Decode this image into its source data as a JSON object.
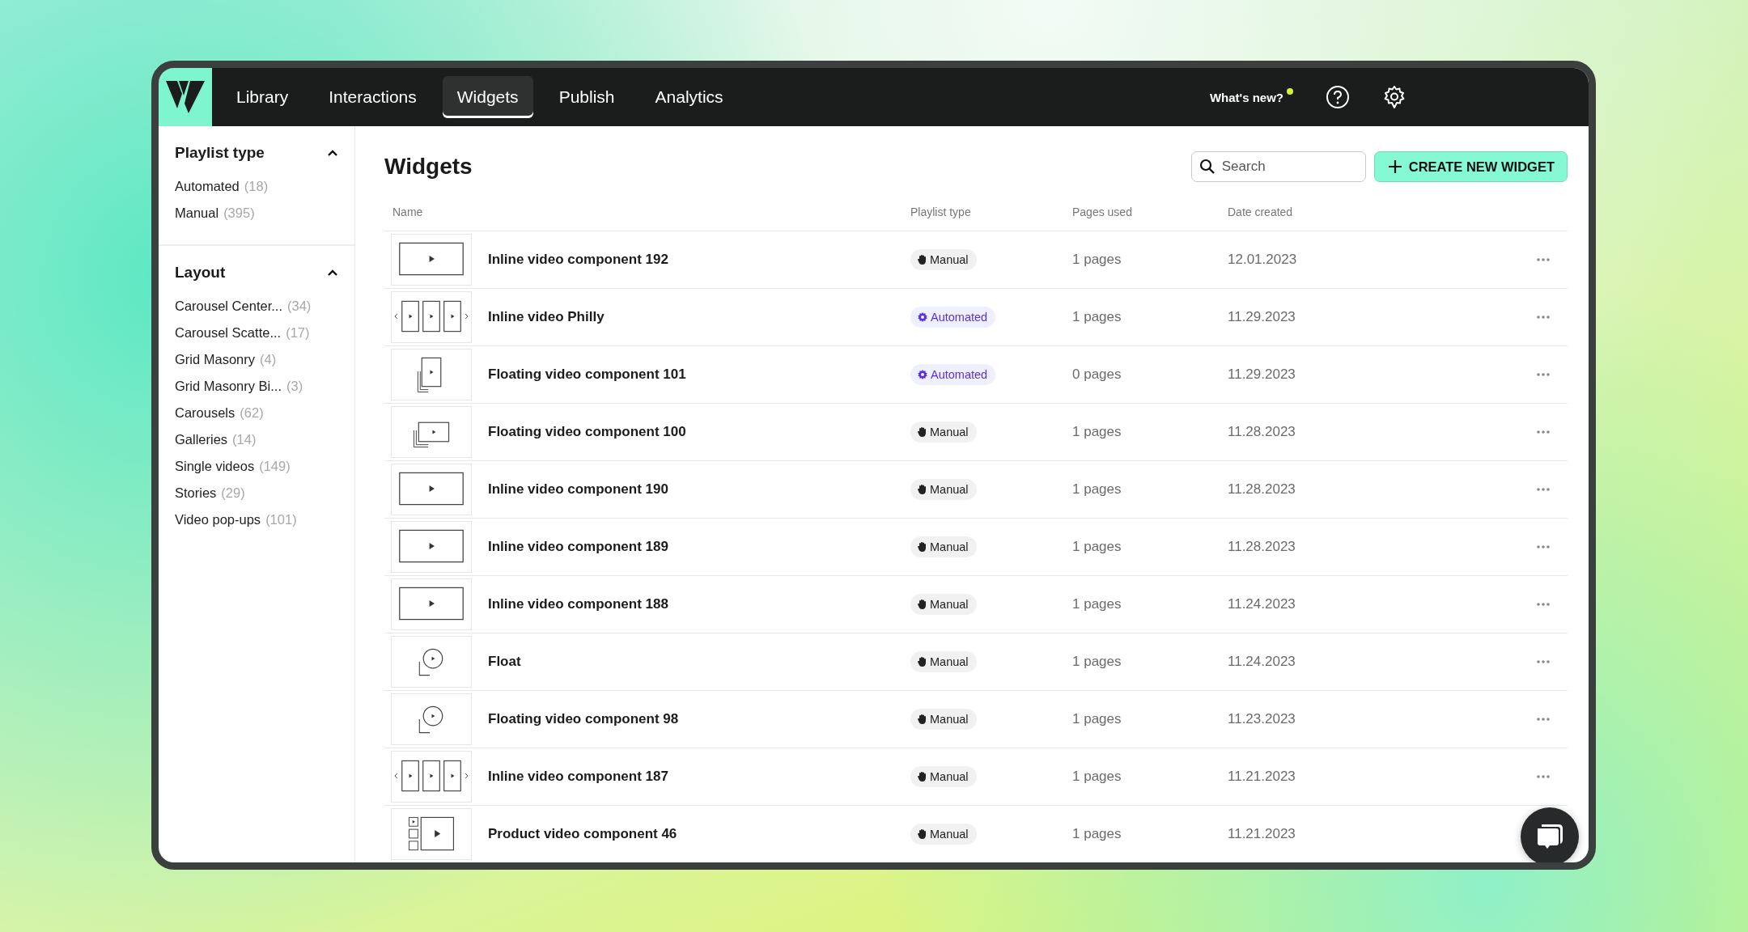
{
  "nav": {
    "tabs": [
      {
        "label": "Library",
        "selected": false
      },
      {
        "label": "Interactions",
        "selected": false
      },
      {
        "label": "Widgets",
        "selected": true
      },
      {
        "label": "Publish",
        "selected": false
      },
      {
        "label": "Analytics",
        "selected": false
      }
    ],
    "whats_new": {
      "label": "What's new?",
      "unread": true
    }
  },
  "sidebar": {
    "sections": [
      {
        "title": "Playlist type",
        "expanded": true,
        "items": [
          {
            "label": "Automated",
            "count": "(18)"
          },
          {
            "label": "Manual",
            "count": "(395)"
          }
        ]
      },
      {
        "title": "Layout",
        "expanded": true,
        "items": [
          {
            "label": "Carousel Center...",
            "count": "(34)"
          },
          {
            "label": "Carousel Scatte...",
            "count": "(17)"
          },
          {
            "label": "Grid Masonry",
            "count": "(4)"
          },
          {
            "label": "Grid Masonry Bi...",
            "count": "(3)"
          },
          {
            "label": "Carousels",
            "count": "(62)"
          },
          {
            "label": "Galleries",
            "count": "(14)"
          },
          {
            "label": "Single videos",
            "count": "(149)"
          },
          {
            "label": "Stories",
            "count": "(29)"
          },
          {
            "label": "Video pop-ups",
            "count": "(101)"
          }
        ]
      }
    ]
  },
  "main": {
    "title": "Widgets",
    "search": {
      "placeholder": "Search"
    },
    "create_button": "CREATE NEW WIDGET",
    "table": {
      "columns": [
        "Name",
        "Playlist type",
        "Pages used",
        "Date created"
      ],
      "rows": [
        {
          "thumbnail": {
            "kind": "single"
          },
          "name": "Inline video component 192",
          "playlist": {
            "kind": "manual",
            "label": "Manual"
          },
          "pages": "1 pages",
          "date": "12.01.2023"
        },
        {
          "thumbnail": {
            "kind": "carousel"
          },
          "name": "Inline video Philly",
          "playlist": {
            "kind": "automated",
            "label": "Automated"
          },
          "pages": "1 pages",
          "date": "11.29.2023"
        },
        {
          "thumbnail": {
            "kind": "floating-portrait"
          },
          "name": "Floating video component 101",
          "playlist": {
            "kind": "automated",
            "label": "Automated"
          },
          "pages": "0 pages",
          "date": "11.29.2023"
        },
        {
          "thumbnail": {
            "kind": "floating-landscape"
          },
          "name": "Floating video component 100",
          "playlist": {
            "kind": "manual",
            "label": "Manual"
          },
          "pages": "1 pages",
          "date": "11.28.2023"
        },
        {
          "thumbnail": {
            "kind": "single"
          },
          "name": "Inline video component 190",
          "playlist": {
            "kind": "manual",
            "label": "Manual"
          },
          "pages": "1 pages",
          "date": "11.28.2023"
        },
        {
          "thumbnail": {
            "kind": "single"
          },
          "name": "Inline video component 189",
          "playlist": {
            "kind": "manual",
            "label": "Manual"
          },
          "pages": "1 pages",
          "date": "11.28.2023"
        },
        {
          "thumbnail": {
            "kind": "single"
          },
          "name": "Inline video component 188",
          "playlist": {
            "kind": "manual",
            "label": "Manual"
          },
          "pages": "1 pages",
          "date": "11.24.2023"
        },
        {
          "thumbnail": {
            "kind": "floating-circle"
          },
          "name": "Float",
          "playlist": {
            "kind": "manual",
            "label": "Manual"
          },
          "pages": "1 pages",
          "date": "11.24.2023"
        },
        {
          "thumbnail": {
            "kind": "floating-circle"
          },
          "name": "Floating video component 98",
          "playlist": {
            "kind": "manual",
            "label": "Manual"
          },
          "pages": "1 pages",
          "date": "11.23.2023"
        },
        {
          "thumbnail": {
            "kind": "carousel"
          },
          "name": "Inline video component 187",
          "playlist": {
            "kind": "manual",
            "label": "Manual"
          },
          "pages": "1 pages",
          "date": "11.21.2023"
        },
        {
          "thumbnail": {
            "kind": "product"
          },
          "name": "Product video component 46",
          "playlist": {
            "kind": "manual",
            "label": "Manual"
          },
          "pages": "1 pages",
          "date": "11.21.2023"
        }
      ]
    }
  }
}
